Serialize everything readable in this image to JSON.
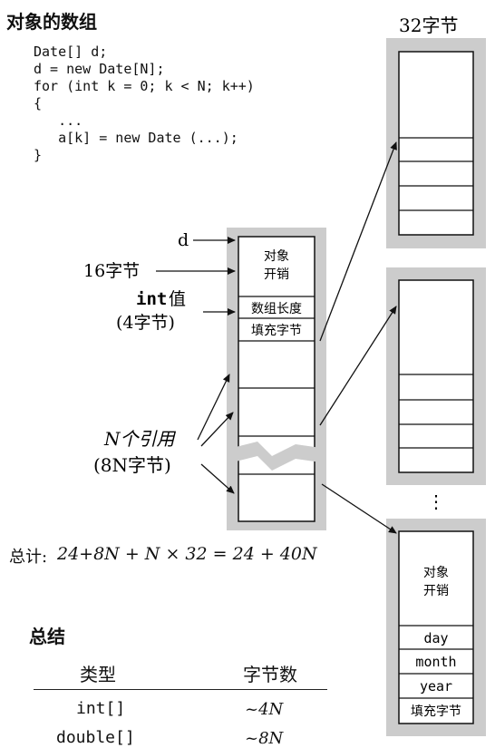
{
  "title": "对象的数组",
  "code": {
    "lines": [
      "Date[] d;",
      "d = new Date[N];",
      "for (int k = 0; k < N; k++)",
      "{",
      "   ...",
      "   a[k] = new Date (...);",
      "}"
    ]
  },
  "array_diagram": {
    "pointer_label": "d",
    "header_label": "16字节",
    "int_label_bold": "int",
    "int_label_suffix": "值",
    "int_size_label": "(4字节)",
    "refs_label_line1": "N个引用",
    "refs_label_line2": "(8N字节)",
    "cell_object_overhead": [
      "对象",
      "开销"
    ],
    "cell_length": "数组长度",
    "cell_padding": "填充字节"
  },
  "object_diagram": {
    "size_label": "32字节",
    "ellipsis": "⋮",
    "cell_object_overhead": [
      "对象",
      "开销"
    ],
    "fields": [
      "day",
      "month",
      "year"
    ],
    "cell_padding": "填充字节"
  },
  "total": {
    "prefix": "总计:",
    "formula": "24+8N + N × 32 = 24 + 40N"
  },
  "summary": {
    "title": "总结",
    "columns": [
      "类型",
      "字节数"
    ],
    "rows": [
      {
        "type": "int[]",
        "bytes": "~4N"
      },
      {
        "type": "double[]",
        "bytes": "~8N"
      }
    ]
  },
  "colors": {
    "frame_gray": "#cccccc",
    "line": "#111111"
  }
}
